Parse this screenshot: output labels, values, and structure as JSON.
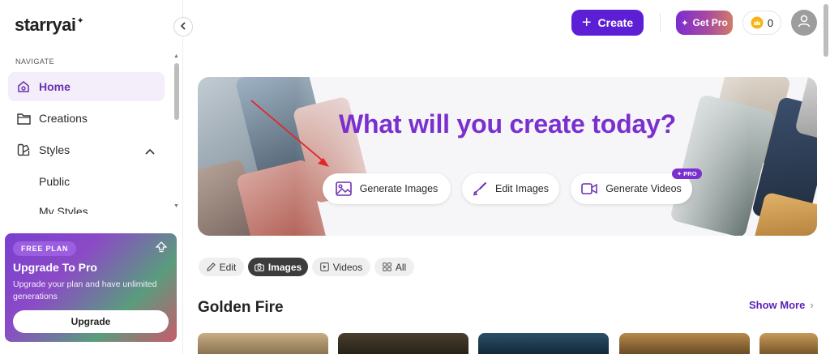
{
  "brand": {
    "logo": "starryai",
    "logo_spark": "✦"
  },
  "header": {
    "create_label": "Create",
    "getpro_label": "Get Pro",
    "credits": "0"
  },
  "sidebar": {
    "heading": "NAVIGATE",
    "items": [
      {
        "label": "Home",
        "icon": "home-icon",
        "active": true
      },
      {
        "label": "Creations",
        "icon": "folder-icon"
      },
      {
        "label": "Styles",
        "icon": "styles-icon",
        "expanded": true
      }
    ],
    "sub_items": [
      "Public",
      "My Styles"
    ]
  },
  "upgrade": {
    "badge": "FREE PLAN",
    "title": "Upgrade To Pro",
    "description": "Upgrade your plan and have unlimited generations",
    "button": "Upgrade"
  },
  "hero": {
    "title": "What will you create today?",
    "actions": [
      {
        "label": "Generate Images",
        "icon": "image-icon"
      },
      {
        "label": "Edit Images",
        "icon": "brush-icon"
      },
      {
        "label": "Generate Videos",
        "icon": "video-icon"
      }
    ],
    "pro_tag": "PRO"
  },
  "filters": [
    {
      "label": "Edit",
      "icon": "pencil-icon"
    },
    {
      "label": "Images",
      "icon": "camera-icon",
      "active": true
    },
    {
      "label": "Videos",
      "icon": "play-icon"
    },
    {
      "label": "All",
      "icon": "grid-icon"
    }
  ],
  "section": {
    "title": "Golden Fire",
    "show_more": "Show More"
  },
  "colors": {
    "accent": "#5c1fd6",
    "hero_title": "#7a2fcf",
    "active_nav_bg": "#f3eef9",
    "annotation_arrow": "#e0282a"
  }
}
